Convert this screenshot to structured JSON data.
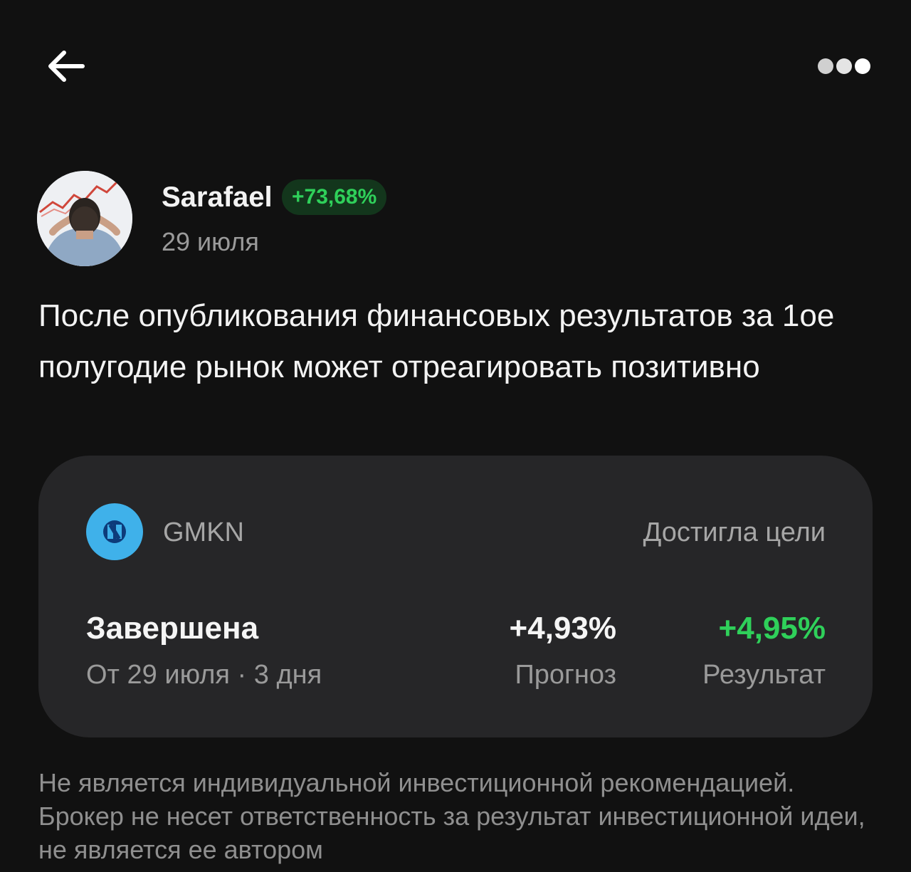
{
  "header": {
    "back_icon": "arrow-left-icon",
    "more_icon": "more-dots-icon"
  },
  "author": {
    "name": "Sarafael",
    "yield": "+73,68%",
    "date": "29 июля",
    "avatar_icon": "user-avatar"
  },
  "post": {
    "text": "После опубликования финансовых результатов за 1ое полугодие рынок может отреагировать позитивно"
  },
  "idea": {
    "ticker": "GMKN",
    "goal_status": "Достигла цели",
    "status": "Завершена",
    "period": "От 29 июля · 3 дня",
    "forecast_value": "+4,93%",
    "forecast_label": "Прогноз",
    "result_value": "+4,95%",
    "result_label": "Результат"
  },
  "disclaimer": "Не является индивидуальной инвестиционной рекомендацией. Брокер не несет ответственность за результат инвестиционной идеи, не является ее автором",
  "colors": {
    "background": "#111111",
    "card": "#262628",
    "positive": "#2fd05a",
    "badge_bg": "#13361c",
    "secondary_text": "#9a9a9a",
    "ticker_logo": "#3fb1ea"
  }
}
